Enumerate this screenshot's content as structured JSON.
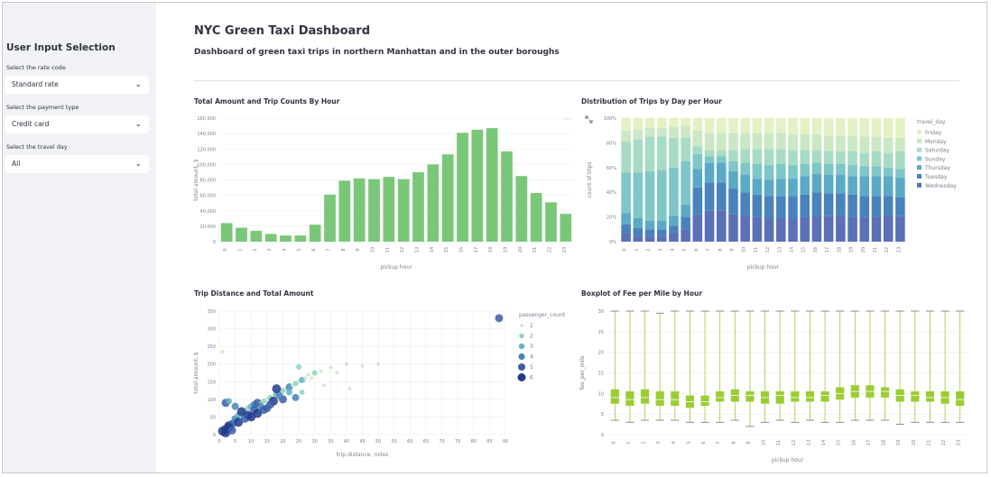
{
  "sidebar": {
    "title": "User Input Selection",
    "rate_label": "Select the rate code",
    "rate_value": "Standard rate",
    "payment_label": "Select the payment type",
    "payment_value": "Credit card",
    "day_label": "Select the travel day",
    "day_value": "All"
  },
  "header": {
    "title": "NYC Green Taxi Dashboard",
    "subtitle": "Dashboard of green taxi trips in northern Manhattan and in the outer boroughs"
  },
  "colors": {
    "bar": "#7bc77a",
    "fee": "#9acd32"
  },
  "icons": {
    "more": "more-icon",
    "expand": "expand-icon"
  },
  "toolbar": {
    "more": "···"
  },
  "chart_data": [
    {
      "type": "bar",
      "title": "Total Amount and Trip Counts By Hour",
      "xlabel": "pickup hour",
      "ylabel": "total amount, $",
      "categories": [
        "0",
        "1",
        "2",
        "3",
        "4",
        "5",
        "6",
        "7",
        "8",
        "9",
        "10",
        "11",
        "12",
        "13",
        "14",
        "15",
        "16",
        "17",
        "18",
        "19",
        "20",
        "21",
        "22",
        "23"
      ],
      "values": [
        24000,
        18000,
        14000,
        10000,
        8000,
        8000,
        22000,
        61000,
        79000,
        82000,
        81000,
        84000,
        81000,
        90000,
        100000,
        113000,
        141000,
        145000,
        147000,
        117000,
        85000,
        63000,
        51000,
        36000
      ],
      "ylim": [
        0,
        160000
      ],
      "yticks": [
        0,
        20000,
        40000,
        60000,
        80000,
        100000,
        120000,
        140000,
        160000
      ],
      "yticklabels": [
        "0",
        "20,000",
        "40,000",
        "60,000",
        "80,000",
        "100,000",
        "120,000",
        "140,000",
        "160,000"
      ]
    },
    {
      "type": "bar",
      "stacked": "normalized",
      "title": "Distribution of Trips by Day per Hour",
      "xlabel": "pickup hour",
      "ylabel": "count of trips",
      "legend_title": "travel_day",
      "legend_position": "right",
      "categories": [
        "0",
        "1",
        "2",
        "3",
        "4",
        "5",
        "6",
        "7",
        "8",
        "9",
        "10",
        "11",
        "12",
        "13",
        "14",
        "15",
        "16",
        "17",
        "18",
        "19",
        "20",
        "21",
        "22",
        "23"
      ],
      "yticklabels": [
        "0%",
        "20%",
        "40%",
        "60%",
        "80%",
        "100%"
      ],
      "series": [
        {
          "name": "Friday",
          "color": "#e3f2c4",
          "values": [
            0.1,
            0.09,
            0.08,
            0.08,
            0.07,
            0.06,
            0.1,
            0.12,
            0.12,
            0.12,
            0.12,
            0.12,
            0.12,
            0.12,
            0.13,
            0.13,
            0.13,
            0.14,
            0.14,
            0.14,
            0.15,
            0.15,
            0.16,
            0.16
          ]
        },
        {
          "name": "Monday",
          "color": "#c9e8c3",
          "values": [
            0.09,
            0.08,
            0.07,
            0.07,
            0.09,
            0.1,
            0.13,
            0.14,
            0.14,
            0.14,
            0.13,
            0.13,
            0.13,
            0.13,
            0.13,
            0.13,
            0.13,
            0.13,
            0.13,
            0.13,
            0.13,
            0.12,
            0.12,
            0.11
          ]
        },
        {
          "name": "Saturday",
          "color": "#a7dbc4",
          "values": [
            0.25,
            0.27,
            0.28,
            0.27,
            0.24,
            0.19,
            0.06,
            0.05,
            0.05,
            0.09,
            0.11,
            0.12,
            0.13,
            0.12,
            0.12,
            0.11,
            0.1,
            0.1,
            0.1,
            0.11,
            0.11,
            0.12,
            0.12,
            0.14
          ]
        },
        {
          "name": "Sunday",
          "color": "#7ec6c8",
          "values": [
            0.33,
            0.37,
            0.4,
            0.41,
            0.39,
            0.35,
            0.12,
            0.05,
            0.05,
            0.08,
            0.1,
            0.12,
            0.12,
            0.12,
            0.11,
            0.1,
            0.09,
            0.09,
            0.09,
            0.09,
            0.08,
            0.08,
            0.07,
            0.07
          ]
        },
        {
          "name": "Thursday",
          "color": "#5aaac6",
          "values": [
            0.09,
            0.08,
            0.07,
            0.07,
            0.08,
            0.1,
            0.15,
            0.16,
            0.16,
            0.14,
            0.14,
            0.13,
            0.13,
            0.14,
            0.14,
            0.15,
            0.15,
            0.15,
            0.15,
            0.15,
            0.16,
            0.16,
            0.16,
            0.16
          ]
        },
        {
          "name": "Tuesday",
          "color": "#4a82bc",
          "values": [
            0.07,
            0.06,
            0.05,
            0.05,
            0.06,
            0.1,
            0.22,
            0.23,
            0.23,
            0.21,
            0.19,
            0.18,
            0.18,
            0.18,
            0.18,
            0.18,
            0.19,
            0.18,
            0.18,
            0.18,
            0.17,
            0.17,
            0.16,
            0.15
          ]
        },
        {
          "name": "Wednesday",
          "color": "#5a70b8",
          "values": [
            0.07,
            0.05,
            0.05,
            0.05,
            0.07,
            0.1,
            0.22,
            0.25,
            0.25,
            0.22,
            0.21,
            0.2,
            0.19,
            0.19,
            0.19,
            0.2,
            0.21,
            0.21,
            0.21,
            0.2,
            0.2,
            0.2,
            0.21,
            0.21
          ]
        }
      ]
    },
    {
      "type": "scatter",
      "title": "Trip Distance and Total Amount",
      "xlabel": "trip distance, miles",
      "ylabel": "total amount, $",
      "xlim": [
        0,
        90
      ],
      "ylim": [
        0,
        350
      ],
      "xticks": [
        0,
        5,
        10,
        15,
        20,
        25,
        30,
        35,
        40,
        45,
        50,
        55,
        60,
        65,
        70,
        75,
        80,
        85,
        90
      ],
      "yticks": [
        0,
        50,
        100,
        150,
        200,
        250,
        300,
        350
      ],
      "legend_title": "passenger_count",
      "legend_position": "right",
      "legend": [
        {
          "label": "1",
          "color": "#c7e9c0"
        },
        {
          "label": "2",
          "color": "#8fd3bf"
        },
        {
          "label": "3",
          "color": "#5fb3c8"
        },
        {
          "label": "4",
          "color": "#4486b9"
        },
        {
          "label": "5",
          "color": "#3b5ea8"
        },
        {
          "label": "6",
          "color": "#233b8c"
        }
      ],
      "points": [
        [
          1,
          235,
          1
        ],
        [
          2,
          15,
          6
        ],
        [
          3,
          25,
          6
        ],
        [
          4,
          30,
          5
        ],
        [
          5,
          45,
          4
        ],
        [
          6,
          55,
          3
        ],
        [
          7,
          60,
          2
        ],
        [
          8,
          70,
          1
        ],
        [
          9,
          75,
          2
        ],
        [
          10,
          80,
          3
        ],
        [
          11,
          85,
          4
        ],
        [
          12,
          90,
          5
        ],
        [
          13,
          88,
          1
        ],
        [
          14,
          95,
          2
        ],
        [
          15,
          100,
          1
        ],
        [
          16,
          105,
          2
        ],
        [
          17,
          110,
          1
        ],
        [
          18,
          115,
          3
        ],
        [
          19,
          120,
          1
        ],
        [
          20,
          125,
          2
        ],
        [
          21,
          130,
          1
        ],
        [
          22,
          135,
          4
        ],
        [
          23,
          140,
          1
        ],
        [
          24,
          145,
          2
        ],
        [
          25,
          150,
          1
        ],
        [
          26,
          155,
          3
        ],
        [
          27,
          160,
          1
        ],
        [
          25,
          192,
          2
        ],
        [
          28,
          170,
          1
        ],
        [
          30,
          175,
          2
        ],
        [
          32,
          180,
          1
        ],
        [
          35,
          190,
          1
        ],
        [
          37,
          176,
          1
        ],
        [
          40,
          200,
          1
        ],
        [
          45,
          195,
          1
        ],
        [
          50,
          200,
          1
        ],
        [
          2,
          90,
          5
        ],
        [
          3,
          95,
          3
        ],
        [
          5,
          80,
          4
        ],
        [
          7,
          65,
          6
        ],
        [
          9,
          55,
          6
        ],
        [
          11,
          70,
          5
        ],
        [
          13,
          80,
          4
        ],
        [
          17,
          95,
          6
        ],
        [
          20,
          100,
          5
        ],
        [
          24,
          105,
          4
        ],
        [
          3,
          20,
          6
        ],
        [
          6,
          35,
          6
        ],
        [
          8,
          45,
          5
        ],
        [
          12,
          60,
          6
        ],
        [
          15,
          75,
          5
        ],
        [
          1,
          10,
          6
        ],
        [
          2,
          5,
          6
        ],
        [
          4,
          12,
          5
        ],
        [
          18,
          130,
          6
        ],
        [
          22,
          120,
          3
        ],
        [
          16,
          85,
          5
        ],
        [
          10,
          50,
          6
        ],
        [
          14,
          70,
          5
        ],
        [
          19,
          110,
          4
        ],
        [
          26,
          120,
          2
        ],
        [
          29,
          160,
          1
        ],
        [
          33,
          140,
          1
        ],
        [
          41,
          130,
          1
        ],
        [
          88,
          330,
          5
        ]
      ]
    },
    {
      "type": "boxplot",
      "title": "Boxplot of Fee per Mile by Hour",
      "xlabel": "pickup hour",
      "ylabel": "fee_per_mile",
      "categories": [
        "0",
        "1",
        "2",
        "3",
        "4",
        "5",
        "6",
        "7",
        "8",
        "9",
        "10",
        "11",
        "12",
        "13",
        "14",
        "15",
        "16",
        "17",
        "18",
        "19",
        "20",
        "21",
        "22",
        "23"
      ],
      "ylim": [
        0,
        30
      ],
      "yticks": [
        0,
        5,
        10,
        15,
        20,
        25,
        30
      ],
      "boxes": [
        [
          3.5,
          7.5,
          9,
          11,
          34.5
        ],
        [
          3,
          7,
          8.5,
          10.5,
          32.5
        ],
        [
          3.5,
          7.5,
          9,
          11,
          30
        ],
        [
          3.5,
          7,
          8.5,
          10.5,
          29.5
        ],
        [
          3.5,
          7,
          8.5,
          10.5,
          33.5
        ],
        [
          3,
          6.5,
          8,
          9.5,
          40
        ],
        [
          3,
          7,
          8,
          9.5,
          46.5
        ],
        [
          3,
          8,
          9,
          10.5,
          35
        ],
        [
          3.5,
          8,
          9.5,
          11,
          43
        ],
        [
          2,
          8,
          9.5,
          10.5,
          38
        ],
        [
          3,
          7.5,
          9,
          10.5,
          48.5
        ],
        [
          3.5,
          7.5,
          9.5,
          10.5,
          50
        ],
        [
          3,
          8,
          9,
          10.5,
          35
        ],
        [
          3.5,
          8,
          9,
          10.5,
          46.5
        ],
        [
          3,
          8,
          9.5,
          10.5,
          40.5
        ],
        [
          3,
          8.5,
          10,
          11.5,
          49.5
        ],
        [
          3.5,
          9,
          10.5,
          12,
          49.5
        ],
        [
          3.5,
          9,
          10.5,
          12,
          50.5
        ],
        [
          3.5,
          9,
          10.5,
          11.5,
          49
        ],
        [
          2.5,
          8,
          9.5,
          11,
          43
        ],
        [
          3,
          8,
          9.5,
          10.5,
          44
        ],
        [
          3,
          8,
          9,
          10.5,
          41.5
        ],
        [
          3,
          7.5,
          9,
          10.5,
          50.5
        ],
        [
          3,
          7,
          8.5,
          10.5,
          44.5
        ]
      ]
    }
  ]
}
